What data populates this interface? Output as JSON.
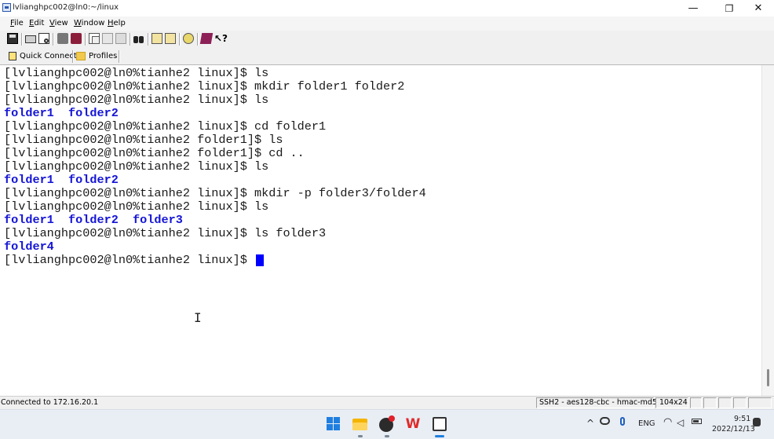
{
  "window": {
    "title": "lvlianghpc002@ln0:~/linux",
    "controls": {
      "minimize": "—",
      "maximize": "❐",
      "close": "✕"
    }
  },
  "menu": [
    "File",
    "Edit",
    "View",
    "Window",
    "Help"
  ],
  "toolbar": {
    "icons": [
      "save-icon",
      "print-icon",
      "print-preview-icon",
      "connect-icon",
      "disconnect-icon",
      "copy-icon",
      "paste-icon",
      "paste-special-icon",
      "find-icon",
      "options-icon",
      "session-options-icon",
      "keymap-icon",
      "help-book-icon",
      "context-help-icon"
    ]
  },
  "quickbar": {
    "quick_connect": "Quick Connect",
    "profiles": "Profiles"
  },
  "terminal": {
    "lines": [
      {
        "text": "[lvlianghpc002@ln0%tianhe2 linux]$ ls",
        "type": "cmd"
      },
      {
        "text": "[lvlianghpc002@ln0%tianhe2 linux]$ mkdir folder1 folder2",
        "type": "cmd"
      },
      {
        "text": "[lvlianghpc002@ln0%tianhe2 linux]$ ls",
        "type": "cmd"
      },
      {
        "text": "folder1  folder2",
        "type": "dir"
      },
      {
        "text": "[lvlianghpc002@ln0%tianhe2 linux]$ cd folder1",
        "type": "cmd"
      },
      {
        "text": "[lvlianghpc002@ln0%tianhe2 folder1]$ ls",
        "type": "cmd"
      },
      {
        "text": "[lvlianghpc002@ln0%tianhe2 folder1]$ cd ..",
        "type": "cmd"
      },
      {
        "text": "[lvlianghpc002@ln0%tianhe2 linux]$ ls",
        "type": "cmd"
      },
      {
        "text": "folder1  folder2",
        "type": "dir"
      },
      {
        "text": "[lvlianghpc002@ln0%tianhe2 linux]$ mkdir -p folder3/folder4",
        "type": "cmd"
      },
      {
        "text": "[lvlianghpc002@ln0%tianhe2 linux]$ ls",
        "type": "cmd"
      },
      {
        "text": "folder1  folder2  folder3",
        "type": "dir"
      },
      {
        "text": "[lvlianghpc002@ln0%tianhe2 linux]$ ls folder3",
        "type": "cmd"
      },
      {
        "text": "folder4",
        "type": "dir"
      },
      {
        "text": "[lvlianghpc002@ln0%tianhe2 linux]$ ",
        "type": "cmd"
      }
    ],
    "cursor_color": "#0000ff",
    "dir_color": "#1515d6"
  },
  "status": {
    "connection": "Connected to 172.16.20.1",
    "protocol": "SSH2 - aes128-cbc - hmac-md5",
    "size": "104x24"
  },
  "taskbar": {
    "apps": [
      "windows-start-icon",
      "file-explorer-icon",
      "media-app-icon",
      "wps-office-icon",
      "terminal-app-icon"
    ],
    "tray": {
      "language": "ENG",
      "time": "9:51",
      "date": "2022/12/13"
    }
  }
}
